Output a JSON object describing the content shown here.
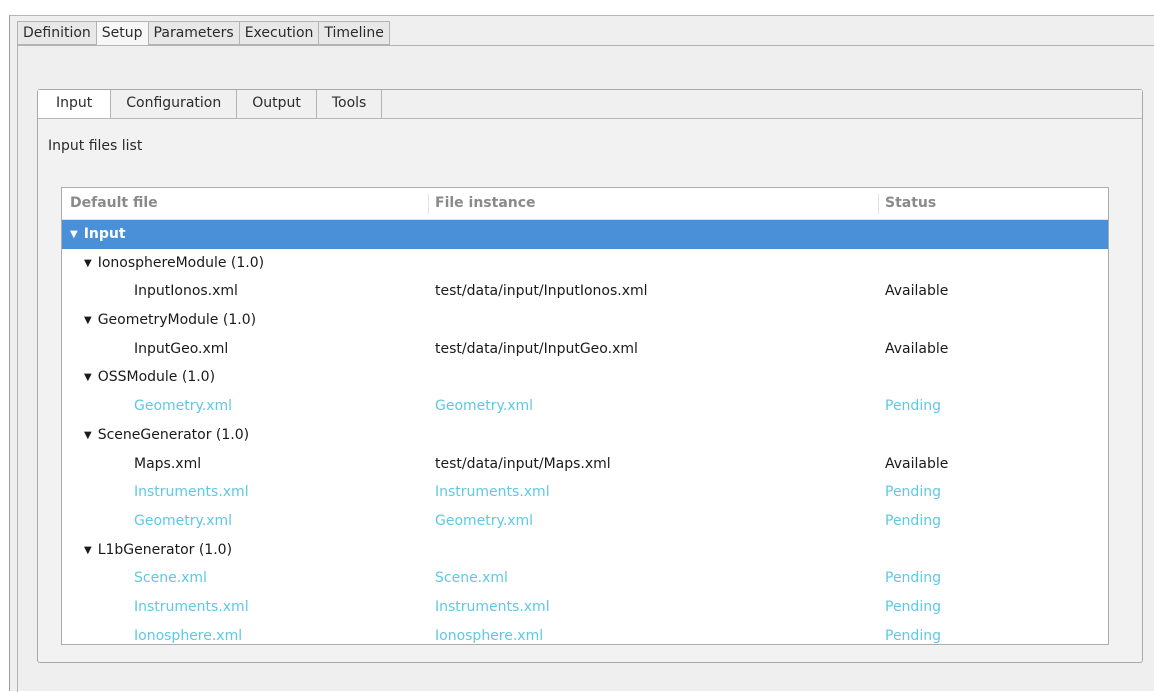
{
  "outer_tabs": [
    "Definition",
    "Setup",
    "Parameters",
    "Execution",
    "Timeline"
  ],
  "outer_active": 1,
  "inner_tabs": [
    "Input",
    "Configuration",
    "Output",
    "Tools"
  ],
  "inner_active": 0,
  "group_label": "Input files list",
  "columns": {
    "default_file": "Default file",
    "file_instance": "File instance",
    "status": "Status"
  },
  "colors": {
    "selection": "#4a90d9",
    "pending": "#5ec8e5"
  },
  "tree": [
    {
      "level": 0,
      "label": "Input",
      "expanded": true,
      "selected": true
    },
    {
      "level": 1,
      "label": "IonosphereModule (1.0)",
      "expanded": true
    },
    {
      "level": 2,
      "label": "InputIonos.xml",
      "instance": "test/data/input/InputIonos.xml",
      "status": "Available"
    },
    {
      "level": 1,
      "label": "GeometryModule (1.0)",
      "expanded": true
    },
    {
      "level": 2,
      "label": "InputGeo.xml",
      "instance": "test/data/input/InputGeo.xml",
      "status": "Available"
    },
    {
      "level": 1,
      "label": "OSSModule (1.0)",
      "expanded": true
    },
    {
      "level": 2,
      "label": "Geometry.xml",
      "instance": "Geometry.xml",
      "status": "Pending"
    },
    {
      "level": 1,
      "label": "SceneGenerator (1.0)",
      "expanded": true
    },
    {
      "level": 2,
      "label": "Maps.xml",
      "instance": "test/data/input/Maps.xml",
      "status": "Available"
    },
    {
      "level": 2,
      "label": "Instruments.xml",
      "instance": "Instruments.xml",
      "status": "Pending"
    },
    {
      "level": 2,
      "label": "Geometry.xml",
      "instance": "Geometry.xml",
      "status": "Pending"
    },
    {
      "level": 1,
      "label": "L1bGenerator (1.0)",
      "expanded": true
    },
    {
      "level": 2,
      "label": "Scene.xml",
      "instance": "Scene.xml",
      "status": "Pending"
    },
    {
      "level": 2,
      "label": "Instruments.xml",
      "instance": "Instruments.xml",
      "status": "Pending"
    },
    {
      "level": 2,
      "label": "Ionosphere.xml",
      "instance": "Ionosphere.xml",
      "status": "Pending"
    }
  ]
}
